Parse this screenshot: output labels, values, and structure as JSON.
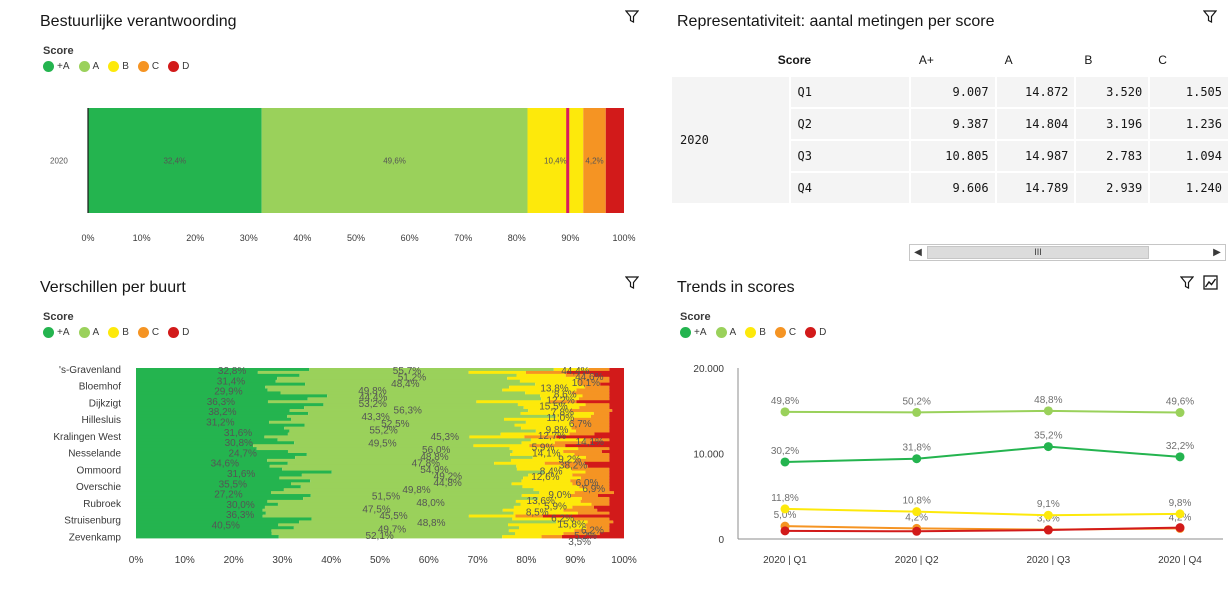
{
  "colors": {
    "Aplus": "#24b44f",
    "A": "#9ad15b",
    "B": "#fde90b",
    "C": "#f59423",
    "D": "#d21a1a",
    "target": "#d81b60"
  },
  "legend": {
    "title": "Score",
    "items": [
      {
        "label": "+A",
        "color": "#24b44f"
      },
      {
        "label": "A",
        "color": "#9ad15b"
      },
      {
        "label": "B",
        "color": "#fde90b"
      },
      {
        "label": "C",
        "color": "#f59423"
      },
      {
        "label": "D",
        "color": "#d21a1a"
      }
    ]
  },
  "panels": {
    "bestuurlijk": {
      "title": "Bestuurlijke verantwoording"
    },
    "representativiteit": {
      "title": "Representativiteit: aantal metingen per score"
    },
    "verschillen": {
      "title": "Verschillen per buurt"
    },
    "trends": {
      "title": "Trends in scores"
    }
  },
  "table": {
    "score_header": "Score",
    "columns": [
      "A+",
      "A",
      "B",
      "C"
    ],
    "year": "2020",
    "rows": [
      {
        "q": "Q1",
        "values": [
          "9.007",
          "14.872",
          "3.520",
          "1.505"
        ]
      },
      {
        "q": "Q2",
        "values": [
          "9.387",
          "14.804",
          "3.196",
          "1.236"
        ]
      },
      {
        "q": "Q3",
        "values": [
          "10.805",
          "14.987",
          "2.783",
          "1.094"
        ]
      },
      {
        "q": "Q4",
        "values": [
          "9.606",
          "14.789",
          "2.939",
          "1.240"
        ]
      }
    ],
    "scroll_thumb": "III"
  },
  "chart_data": [
    {
      "type": "bar",
      "stacked": true,
      "orientation": "horizontal",
      "categories": [
        "2020"
      ],
      "series": [
        {
          "name": "+A",
          "values": [
            32.4
          ],
          "label": "32,4%"
        },
        {
          "name": "A",
          "values": [
            49.6
          ],
          "label": "49,6%"
        },
        {
          "name": "B",
          "values": [
            10.4
          ],
          "label": "10,4%"
        },
        {
          "name": "C",
          "values": [
            4.2
          ],
          "label": "4,2%"
        },
        {
          "name": "D",
          "values": [
            3.4
          ],
          "label": ""
        }
      ],
      "target_line": 89.5,
      "xlim": [
        0,
        100
      ],
      "xticks": [
        "0%",
        "10%",
        "20%",
        "30%",
        "40%",
        "50%",
        "60%",
        "70%",
        "80%",
        "90%",
        "100%"
      ]
    },
    {
      "type": "bar",
      "stacked": true,
      "orientation": "horizontal",
      "categories": [
        "'s-Gravenland",
        "Bloemhof",
        "Dijkzigt",
        "Hillesluis",
        "Kralingen West",
        "Nesselande",
        "Ommoord",
        "Overschie",
        "Rubroek",
        "Struisenburg",
        "Zevenkamp"
      ],
      "series": [
        {
          "name": "+A",
          "values": [
            32.8,
            31.4,
            29.9,
            36.3,
            38.2,
            31.2,
            31.6,
            30.8,
            24.7,
            34.6,
            31.6,
            35.5,
            27.2,
            30.0,
            36.3,
            40.5
          ]
        },
        {
          "name": "A",
          "values": [
            49.8,
            53.2,
            56.3,
            43.3,
            45.3,
            55.2,
            49.5,
            48.8,
            54.9,
            49.2,
            44.8,
            49.8,
            48.0,
            47.5,
            48.8,
            49.7
          ]
        },
        {
          "name": "B",
          "values": [
            10.1,
            13.8,
            12.2,
            15.5,
            11.0,
            7.8,
            12.7,
            14.1,
            14.1,
            8.4,
            12.6,
            6.9,
            9.0,
            13.6,
            8.5,
            15.8
          ]
        },
        {
          "name": "C",
          "values": [
            5.2,
            8.6,
            3.5,
            6.7,
            9.8,
            5.9,
            9.2,
            6.0,
            5.9,
            6.2
          ]
        },
        {
          "name": "D",
          "values": []
        }
      ],
      "visible_labels": [
        "32,8%",
        "31,4%",
        "29,9%",
        "36,3%",
        "38,2%",
        "31,2%",
        "31,6%",
        "30,8%",
        "24,7%",
        "34,6%",
        "31,6%",
        "35,5%",
        "27,2%",
        "30,0%",
        "36,3%",
        "40,5%",
        "55,7%",
        "51,2%",
        "48,4%",
        "49,8%",
        "44,4%",
        "53,2%",
        "56,3%",
        "43,3%",
        "52,5%",
        "55,2%",
        "45,3%",
        "49,5%",
        "56,0%",
        "48,8%",
        "47,8%",
        "54,9%",
        "49,2%",
        "44,8%",
        "49,8%",
        "51,5%",
        "48,0%",
        "47,5%",
        "45,5%",
        "48,8%",
        "49,7%",
        "52,1%",
        "44,4%",
        "44,6%",
        "10,1%",
        "13,8%",
        "8,6%",
        "12,2%",
        "15,5%",
        "7,8%",
        "11,0%",
        "6,7%",
        "9,8%",
        "12,7%",
        "14,1%",
        "5,9%",
        "14,1%",
        "9,2%",
        "38,2%",
        "8,4%",
        "12,6%",
        "6,0%",
        "6,9%",
        "9,0%",
        "13,6%",
        "5,9%",
        "8,5%",
        "6,2%",
        "15,8%",
        "6,2%",
        "5,2%",
        "3,5%"
      ],
      "xlim": [
        0,
        100
      ],
      "xticks": [
        "0%",
        "10%",
        "20%",
        "30%",
        "40%",
        "50%",
        "60%",
        "70%",
        "80%",
        "90%",
        "100%"
      ]
    },
    {
      "type": "line",
      "x": [
        "2020 | Q1",
        "2020 | Q2",
        "2020 | Q3",
        "2020 | Q4"
      ],
      "series": [
        {
          "name": "+A",
          "values": [
            9007,
            9387,
            10805,
            9606
          ],
          "labels": [
            "30,2%",
            "31,8%",
            "35,2%",
            "32,2%"
          ]
        },
        {
          "name": "A",
          "values": [
            14872,
            14804,
            14987,
            14789
          ],
          "labels": [
            "49,8%",
            "50,2%",
            "48,8%",
            "49,6%"
          ]
        },
        {
          "name": "B",
          "values": [
            3520,
            3196,
            2783,
            2939
          ],
          "labels": [
            "11,8%",
            "10,8%",
            "9,1%",
            "9,8%"
          ]
        },
        {
          "name": "C",
          "values": [
            1505,
            1236,
            1094,
            1240
          ],
          "labels": [
            "5,0%",
            "4,2%",
            "3,6%",
            "4,2%"
          ]
        },
        {
          "name": "D",
          "values": [
            950,
            900,
            1050,
            1330
          ],
          "labels": [
            "",
            "",
            "",
            ""
          ]
        }
      ],
      "ylim": [
        0,
        20000
      ],
      "yticks": [
        "0",
        "10.000",
        "20.000"
      ]
    }
  ]
}
